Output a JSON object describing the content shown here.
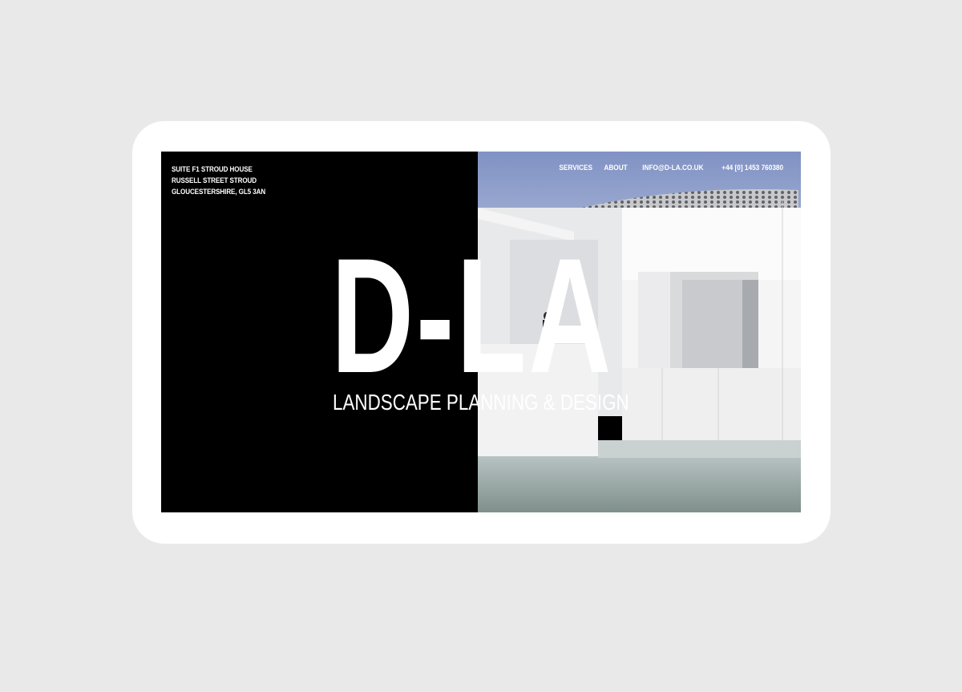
{
  "address": {
    "line1": "SUITE F1 STROUD HOUSE",
    "line2": "RUSSELL STREET STROUD",
    "line3": "GLOUCESTERSHIRE, GL5 3AN"
  },
  "nav": {
    "services": "SERVICES",
    "about": "ABOUT",
    "email": "INFO@D-LA.CO.UK",
    "phone": "+44 [0] 1453 760380"
  },
  "hero": {
    "logo": "D-LA",
    "tagline": "LANDSCAPE PLANNING & DESIGN"
  },
  "colors": {
    "background": "#e9e9e9",
    "device": "#ffffff",
    "left_panel": "#000000",
    "text": "#ffffff",
    "sky": "#8a9cc8"
  }
}
